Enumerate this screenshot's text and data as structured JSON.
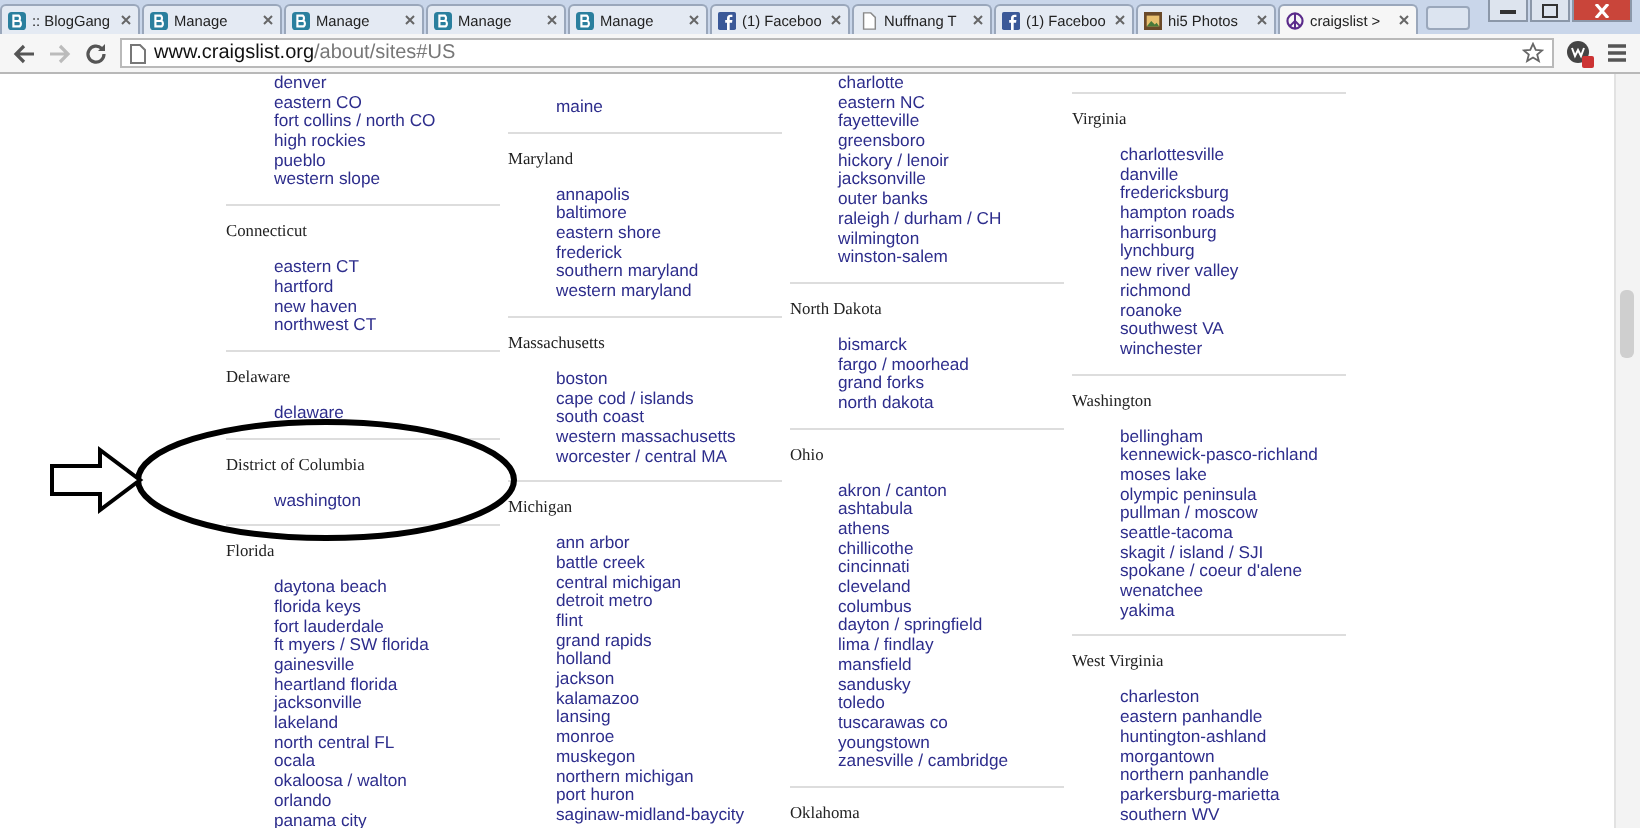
{
  "browser": {
    "tabs": [
      {
        "title": ":: BlogGang",
        "kind": "blog",
        "selected": false
      },
      {
        "title": "Manage",
        "kind": "blog",
        "selected": false
      },
      {
        "title": "Manage",
        "kind": "blog",
        "selected": false
      },
      {
        "title": "Manage",
        "kind": "blog",
        "selected": false
      },
      {
        "title": "Manage",
        "kind": "blog",
        "selected": false
      },
      {
        "title": "(1) Faceboo",
        "kind": "facebook",
        "selected": false
      },
      {
        "title": "Nuffnang T",
        "kind": "page",
        "selected": false
      },
      {
        "title": "(1) Faceboo",
        "kind": "facebook",
        "selected": false
      },
      {
        "title": "hi5 Photos",
        "kind": "photo",
        "selected": false
      },
      {
        "title": "craigslist >",
        "kind": "peace",
        "selected": true
      }
    ],
    "address": {
      "host": "www.craigslist.org",
      "path": "/about/sites#US"
    }
  },
  "columns": [
    {
      "items": [
        {
          "kind": "link",
          "text": "denver"
        },
        {
          "kind": "link",
          "text": "eastern CO"
        },
        {
          "kind": "link",
          "text": "fort collins / north CO"
        },
        {
          "kind": "link",
          "text": "high rockies"
        },
        {
          "kind": "link",
          "text": "pueblo"
        },
        {
          "kind": "link",
          "text": "western slope"
        },
        {
          "kind": "rule"
        },
        {
          "kind": "heading",
          "text": "Connecticut"
        },
        {
          "kind": "link",
          "text": "eastern CT"
        },
        {
          "kind": "link",
          "text": "hartford"
        },
        {
          "kind": "link",
          "text": "new haven"
        },
        {
          "kind": "link",
          "text": "northwest CT"
        },
        {
          "kind": "rule"
        },
        {
          "kind": "heading",
          "text": "Delaware"
        },
        {
          "kind": "link",
          "text": "delaware"
        },
        {
          "kind": "rule"
        },
        {
          "kind": "heading",
          "text": "District of Columbia"
        },
        {
          "kind": "link",
          "text": "washington"
        },
        {
          "kind": "rule"
        },
        {
          "kind": "heading",
          "text": "Florida"
        },
        {
          "kind": "link",
          "text": "daytona beach"
        },
        {
          "kind": "link",
          "text": "florida keys"
        },
        {
          "kind": "link",
          "text": "fort lauderdale"
        },
        {
          "kind": "link",
          "text": "ft myers / SW florida"
        },
        {
          "kind": "link",
          "text": "gainesville"
        },
        {
          "kind": "link",
          "text": "heartland florida"
        },
        {
          "kind": "link",
          "text": "jacksonville"
        },
        {
          "kind": "link",
          "text": "lakeland"
        },
        {
          "kind": "link",
          "text": "north central FL"
        },
        {
          "kind": "link",
          "text": "ocala"
        },
        {
          "kind": "link",
          "text": "okaloosa / walton"
        },
        {
          "kind": "link",
          "text": "orlando"
        },
        {
          "kind": "link",
          "text": "panama city"
        }
      ]
    },
    {
      "items": [
        {
          "kind": "link",
          "text": "maine"
        },
        {
          "kind": "rule"
        },
        {
          "kind": "heading",
          "text": "Maryland"
        },
        {
          "kind": "link",
          "text": "annapolis"
        },
        {
          "kind": "link",
          "text": "baltimore"
        },
        {
          "kind": "link",
          "text": "eastern shore"
        },
        {
          "kind": "link",
          "text": "frederick"
        },
        {
          "kind": "link",
          "text": "southern maryland"
        },
        {
          "kind": "link",
          "text": "western maryland"
        },
        {
          "kind": "rule"
        },
        {
          "kind": "heading",
          "text": "Massachusetts"
        },
        {
          "kind": "link",
          "text": "boston"
        },
        {
          "kind": "link",
          "text": "cape cod / islands"
        },
        {
          "kind": "link",
          "text": "south coast"
        },
        {
          "kind": "link",
          "text": "western massachusetts"
        },
        {
          "kind": "link",
          "text": "worcester / central MA"
        },
        {
          "kind": "rule"
        },
        {
          "kind": "heading",
          "text": "Michigan"
        },
        {
          "kind": "link",
          "text": "ann arbor"
        },
        {
          "kind": "link",
          "text": "battle creek"
        },
        {
          "kind": "link",
          "text": "central michigan"
        },
        {
          "kind": "link",
          "text": "detroit metro"
        },
        {
          "kind": "link",
          "text": "flint"
        },
        {
          "kind": "link",
          "text": "grand rapids"
        },
        {
          "kind": "link",
          "text": "holland"
        },
        {
          "kind": "link",
          "text": "jackson"
        },
        {
          "kind": "link",
          "text": "kalamazoo"
        },
        {
          "kind": "link",
          "text": "lansing"
        },
        {
          "kind": "link",
          "text": "monroe"
        },
        {
          "kind": "link",
          "text": "muskegon"
        },
        {
          "kind": "link",
          "text": "northern michigan"
        },
        {
          "kind": "link",
          "text": "port huron"
        },
        {
          "kind": "link",
          "text": "saginaw-midland-baycity"
        }
      ]
    },
    {
      "items": [
        {
          "kind": "link",
          "text": "charlotte"
        },
        {
          "kind": "link",
          "text": "eastern NC"
        },
        {
          "kind": "link",
          "text": "fayetteville"
        },
        {
          "kind": "link",
          "text": "greensboro"
        },
        {
          "kind": "link",
          "text": "hickory / lenoir"
        },
        {
          "kind": "link",
          "text": "jacksonville"
        },
        {
          "kind": "link",
          "text": "outer banks"
        },
        {
          "kind": "link",
          "text": "raleigh / durham / CH"
        },
        {
          "kind": "link",
          "text": "wilmington"
        },
        {
          "kind": "link",
          "text": "winston-salem"
        },
        {
          "kind": "rule"
        },
        {
          "kind": "heading",
          "text": "North Dakota"
        },
        {
          "kind": "link",
          "text": "bismarck"
        },
        {
          "kind": "link",
          "text": "fargo / moorhead"
        },
        {
          "kind": "link",
          "text": "grand forks"
        },
        {
          "kind": "link",
          "text": "north dakota"
        },
        {
          "kind": "rule"
        },
        {
          "kind": "heading",
          "text": "Ohio"
        },
        {
          "kind": "link",
          "text": "akron / canton"
        },
        {
          "kind": "link",
          "text": "ashtabula"
        },
        {
          "kind": "link",
          "text": "athens"
        },
        {
          "kind": "link",
          "text": "chillicothe"
        },
        {
          "kind": "link",
          "text": "cincinnati"
        },
        {
          "kind": "link",
          "text": "cleveland"
        },
        {
          "kind": "link",
          "text": "columbus"
        },
        {
          "kind": "link",
          "text": "dayton / springfield"
        },
        {
          "kind": "link",
          "text": "lima / findlay"
        },
        {
          "kind": "link",
          "text": "mansfield"
        },
        {
          "kind": "link",
          "text": "sandusky"
        },
        {
          "kind": "link",
          "text": "toledo"
        },
        {
          "kind": "link",
          "text": "tuscarawas co"
        },
        {
          "kind": "link",
          "text": "youngstown"
        },
        {
          "kind": "link",
          "text": "zanesville / cambridge"
        },
        {
          "kind": "rule"
        },
        {
          "kind": "heading",
          "text": "Oklahoma"
        }
      ]
    },
    {
      "items": [
        {
          "kind": "rule"
        },
        {
          "kind": "heading",
          "text": "Virginia"
        },
        {
          "kind": "link",
          "text": "charlottesville"
        },
        {
          "kind": "link",
          "text": "danville"
        },
        {
          "kind": "link",
          "text": "fredericksburg"
        },
        {
          "kind": "link",
          "text": "hampton roads"
        },
        {
          "kind": "link",
          "text": "harrisonburg"
        },
        {
          "kind": "link",
          "text": "lynchburg"
        },
        {
          "kind": "link",
          "text": "new river valley"
        },
        {
          "kind": "link",
          "text": "richmond"
        },
        {
          "kind": "link",
          "text": "roanoke"
        },
        {
          "kind": "link",
          "text": "southwest VA"
        },
        {
          "kind": "link",
          "text": "winchester"
        },
        {
          "kind": "rule"
        },
        {
          "kind": "heading",
          "text": "Washington"
        },
        {
          "kind": "link",
          "text": "bellingham"
        },
        {
          "kind": "link",
          "text": "kennewick-pasco-richland"
        },
        {
          "kind": "link",
          "text": "moses lake"
        },
        {
          "kind": "link",
          "text": "olympic peninsula"
        },
        {
          "kind": "link",
          "text": "pullman / moscow"
        },
        {
          "kind": "link",
          "text": "seattle-tacoma"
        },
        {
          "kind": "link",
          "text": "skagit / island / SJI"
        },
        {
          "kind": "link",
          "text": "spokane / coeur d'alene"
        },
        {
          "kind": "link",
          "text": "wenatchee"
        },
        {
          "kind": "link",
          "text": "yakima"
        },
        {
          "kind": "rule"
        },
        {
          "kind": "heading",
          "text": "West Virginia"
        },
        {
          "kind": "link",
          "text": "charleston"
        },
        {
          "kind": "link",
          "text": "eastern panhandle"
        },
        {
          "kind": "link",
          "text": "huntington-ashland"
        },
        {
          "kind": "link",
          "text": "morgantown"
        },
        {
          "kind": "link",
          "text": "northern panhandle"
        },
        {
          "kind": "link",
          "text": "parkersburg-marietta"
        },
        {
          "kind": "link",
          "text": "southern WV"
        }
      ]
    }
  ]
}
